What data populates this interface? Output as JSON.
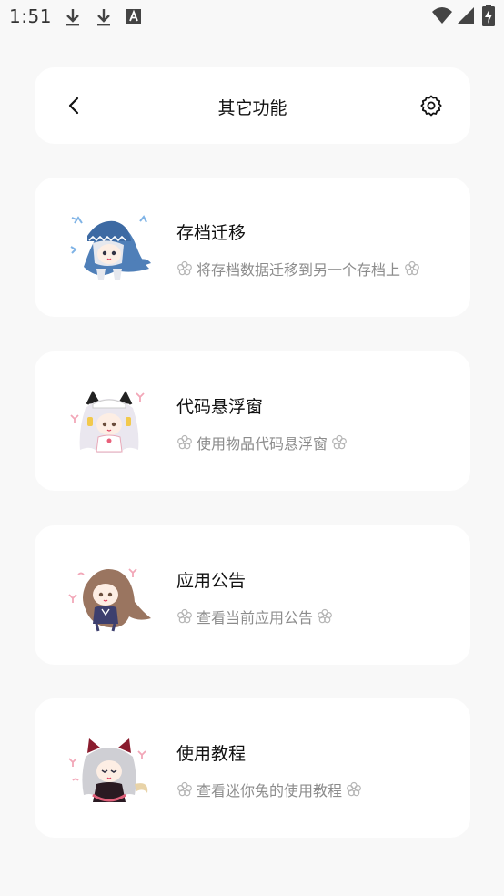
{
  "status_bar": {
    "time": "1:51",
    "left_icons": [
      "download-icon",
      "download-icon",
      "font-a-icon"
    ],
    "right_icons": [
      "wifi-icon",
      "signal-icon",
      "battery-charging-icon"
    ]
  },
  "header": {
    "title": "其它功能",
    "back_icon": "chevron-left-icon",
    "settings_icon": "gear-icon"
  },
  "features": [
    {
      "title": "存档迁移",
      "desc": "将存档数据迁移到另一个存档上",
      "art": "chibi-shark-hood-character",
      "accent": "#7fb3e6"
    },
    {
      "title": "代码悬浮窗",
      "desc": "使用物品代码悬浮窗",
      "art": "chibi-maid-character",
      "accent": "#f2a7b8"
    },
    {
      "title": "应用公告",
      "desc": "查看当前应用公告",
      "art": "chibi-brown-hair-character",
      "accent": "#f2a7b8"
    },
    {
      "title": "使用教程",
      "desc": "查看迷你兔的使用教程",
      "art": "chibi-cat-ear-character",
      "accent": "#e0607a"
    }
  ],
  "colors": {
    "background": "#f8f8f8",
    "card": "#ffffff",
    "title_text": "#111111",
    "desc_text": "#8c8c8c"
  }
}
